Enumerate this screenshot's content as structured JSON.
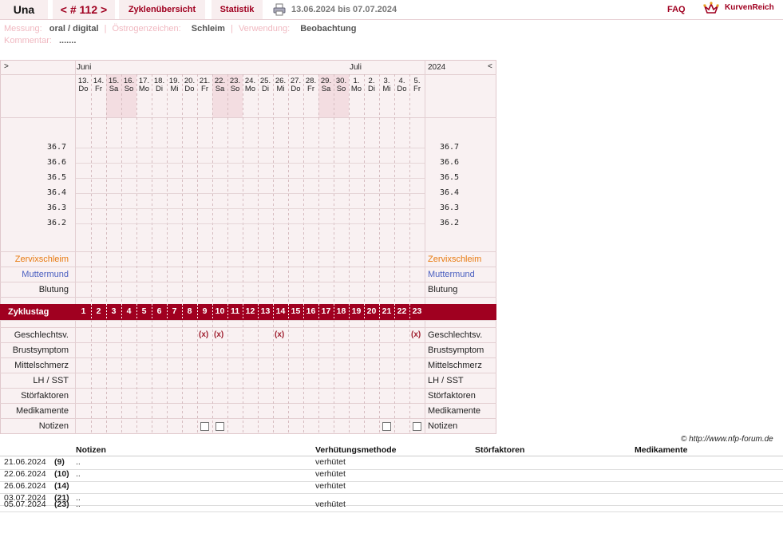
{
  "header": {
    "user": "Una",
    "cycle": "< # 112 >",
    "tabs": [
      "Zyklenübersicht",
      "Statistik"
    ],
    "date_range": "13.06.2024 bis 07.07.2024",
    "faq": "FAQ",
    "logo_text": "KurvenReich",
    "print_icon": "printer-icon"
  },
  "info": {
    "messung_label": "Messung:",
    "messung_value": "oral / digital",
    "oestrogen_label": "Östrogenzeichen:",
    "oestrogen_value": "Schleim",
    "verwendung_label": "Verwendung:",
    "verwendung_value": "Beobachtung",
    "kommentar_label": "Kommentar:",
    "kommentar_value": "......."
  },
  "chart": {
    "nav_left": ">",
    "nav_right": "<",
    "year": "2024",
    "month1": "Juni",
    "month2": "Juli",
    "days": [
      {
        "d": "13.",
        "w": "Do",
        "we": false
      },
      {
        "d": "14.",
        "w": "Fr",
        "we": false
      },
      {
        "d": "15.",
        "w": "Sa",
        "we": true
      },
      {
        "d": "16.",
        "w": "So",
        "we": true
      },
      {
        "d": "17.",
        "w": "Mo",
        "we": false
      },
      {
        "d": "18.",
        "w": "Di",
        "we": false
      },
      {
        "d": "19.",
        "w": "Mi",
        "we": false
      },
      {
        "d": "20.",
        "w": "Do",
        "we": false
      },
      {
        "d": "21.",
        "w": "Fr",
        "we": false
      },
      {
        "d": "22.",
        "w": "Sa",
        "we": true
      },
      {
        "d": "23.",
        "w": "So",
        "we": true
      },
      {
        "d": "24.",
        "w": "Mo",
        "we": false
      },
      {
        "d": "25.",
        "w": "Di",
        "we": false
      },
      {
        "d": "26.",
        "w": "Mi",
        "we": false
      },
      {
        "d": "27.",
        "w": "Do",
        "we": false
      },
      {
        "d": "28.",
        "w": "Fr",
        "we": false
      },
      {
        "d": "29.",
        "w": "Sa",
        "we": true
      },
      {
        "d": "30.",
        "w": "So",
        "we": true
      },
      {
        "d": "1.",
        "w": "Mo",
        "we": false
      },
      {
        "d": "2.",
        "w": "Di",
        "we": false
      },
      {
        "d": "3.",
        "w": "Mi",
        "we": false
      },
      {
        "d": "4.",
        "w": "Do",
        "we": false
      },
      {
        "d": "5.",
        "w": "Fr",
        "we": false
      }
    ],
    "temps": [
      "36.7",
      "36.6",
      "36.5",
      "36.4",
      "36.3",
      "36.2"
    ],
    "rows_top": [
      {
        "label": "Zervixschleim",
        "color": "#e87a10"
      },
      {
        "label": "Muttermund",
        "color": "#4a5fc0"
      },
      {
        "label": "Blutung",
        "color": "#222222"
      }
    ],
    "zyklustag_label": "Zyklustag",
    "zyklustage": [
      "1",
      "2",
      "3",
      "4",
      "5",
      "6",
      "7",
      "8",
      "9",
      "10",
      "11",
      "12",
      "13",
      "14",
      "15",
      "16",
      "17",
      "18",
      "19",
      "20",
      "21",
      "22",
      "23"
    ],
    "rows_bottom": [
      "Geschlechtsv.",
      "Brustsymptom",
      "Mittelschmerz",
      "LH / SST",
      "Störfaktoren",
      "Medikamente",
      "Notizen"
    ],
    "sex_marks": [
      {
        "col": 8,
        "text": "(x)"
      },
      {
        "col": 9,
        "text": "(x)"
      },
      {
        "col": 13,
        "text": "(x)"
      },
      {
        "col": 22,
        "text": "(x)"
      }
    ],
    "note_cols": [
      8,
      9,
      20,
      22
    ],
    "accent": "#a00020"
  },
  "copyright": "© http://www.nfp-forum.de",
  "table": {
    "headers": [
      "Notizen",
      "Verhütungsmethode",
      "Störfaktoren",
      "Medikamente"
    ],
    "rows": [
      {
        "date": "21.06.2024",
        "day": "(9)",
        "note": "..",
        "method": "verhütet"
      },
      {
        "date": "22.06.2024",
        "day": "(10)",
        "note": "..",
        "method": "verhütet"
      },
      {
        "date": "26.06.2024",
        "day": "(14)",
        "note": "",
        "method": "verhütet"
      },
      {
        "date": "03.07.2024",
        "day": "(21)",
        "note": "..",
        "method": ""
      },
      {
        "date": "05.07.2024",
        "day": "(23)",
        "note": "..",
        "method": "verhütet"
      }
    ]
  }
}
